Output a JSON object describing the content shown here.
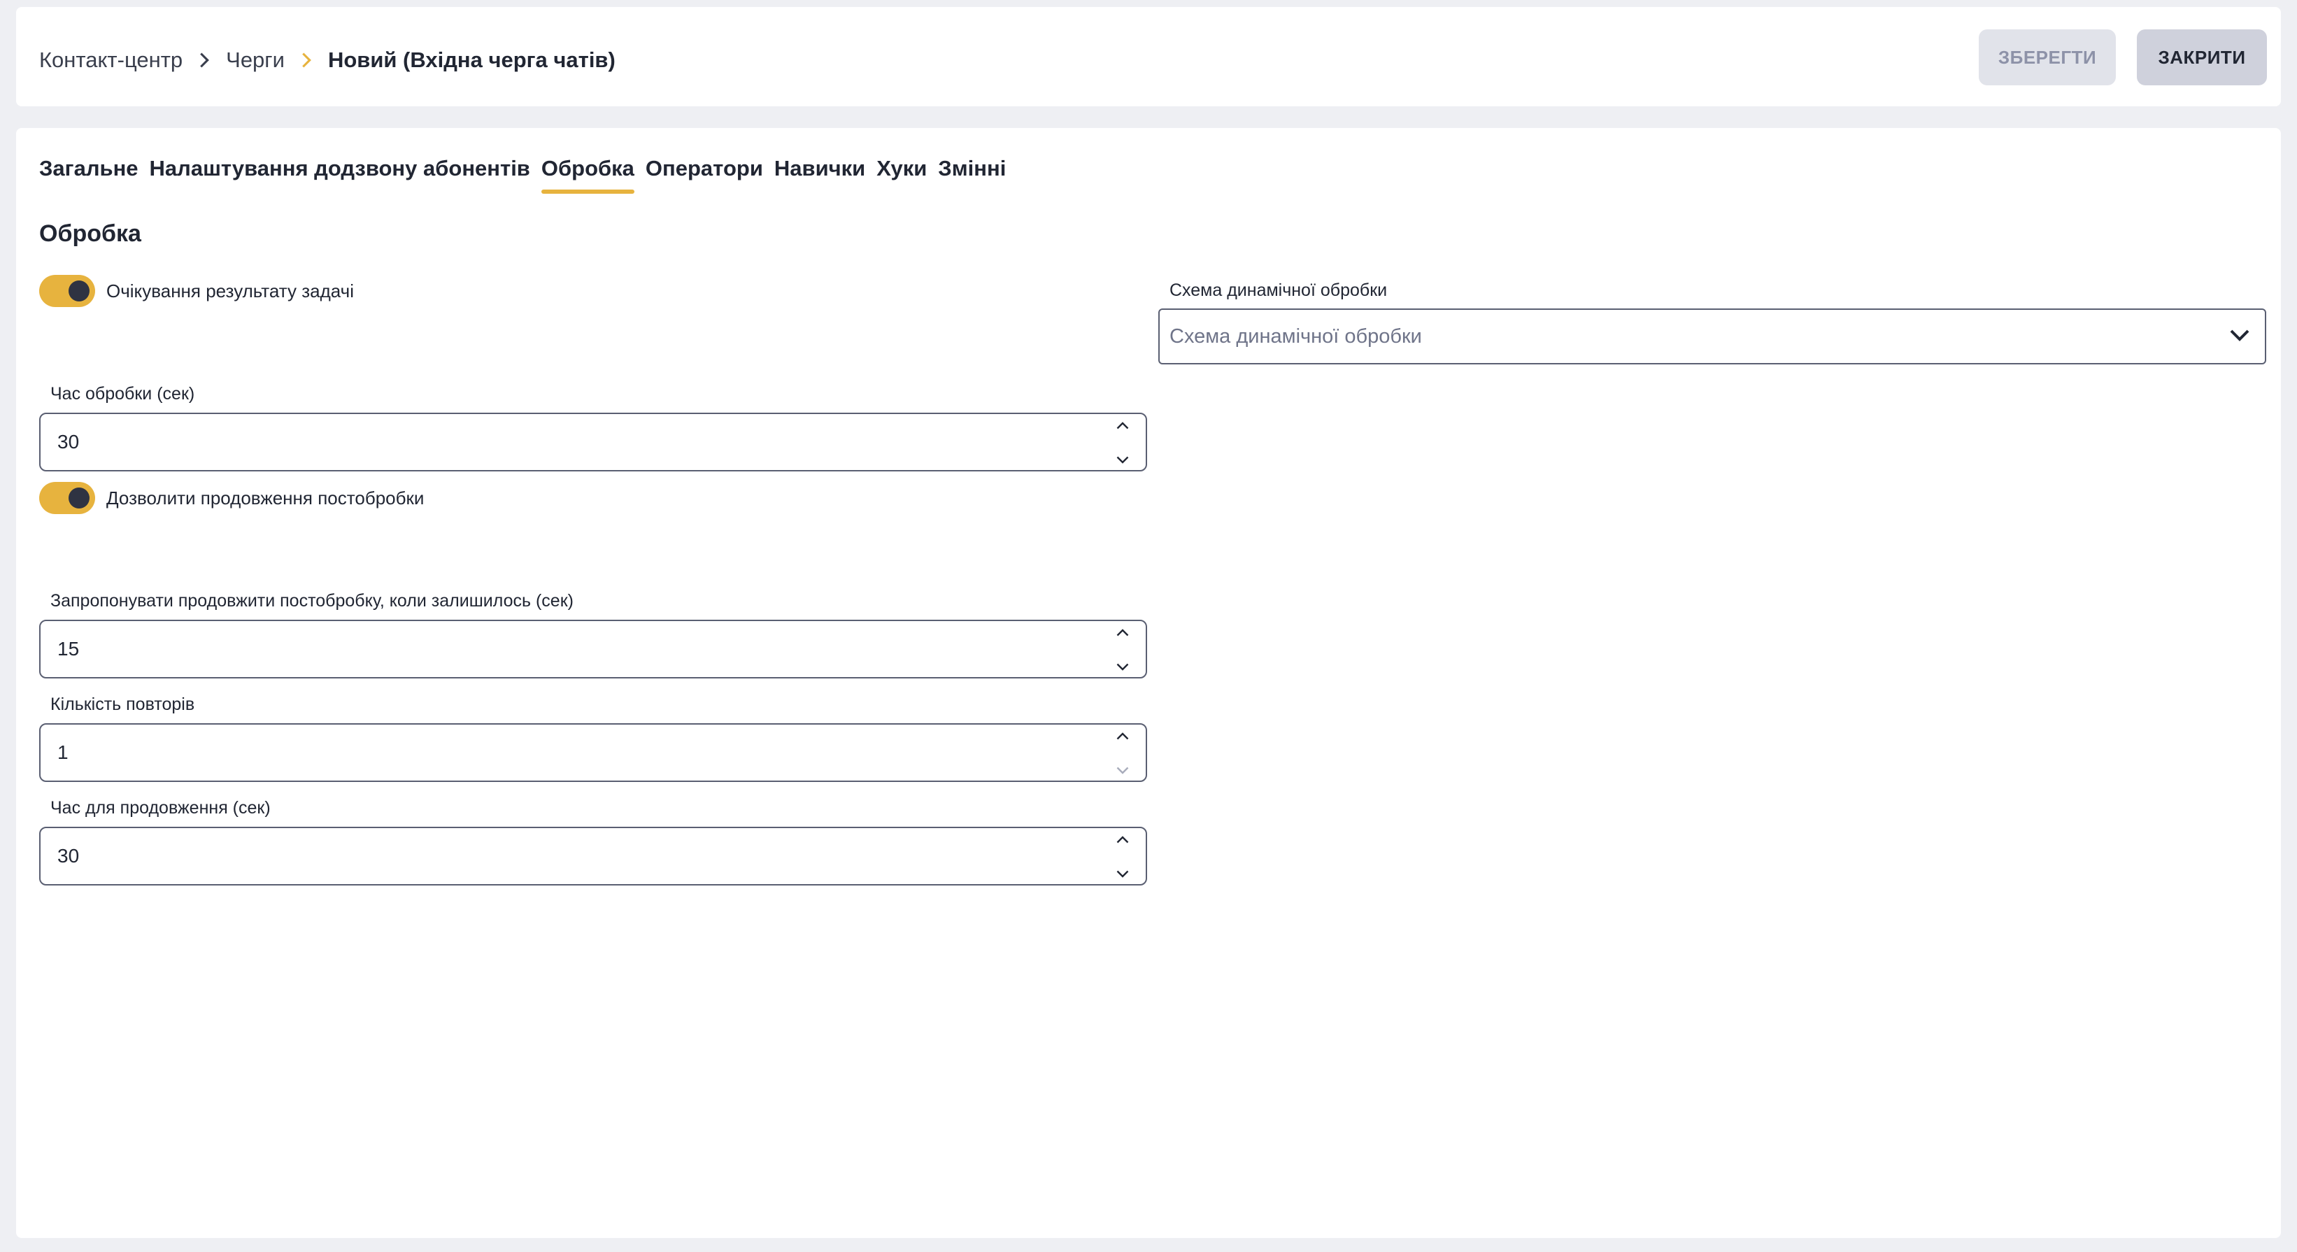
{
  "breadcrumb": {
    "items": [
      "Контакт-центр",
      "Черги"
    ],
    "current": "Новий (Вхідна черга чатів)"
  },
  "header": {
    "save_label": "ЗБЕРЕГТИ",
    "close_label": "ЗАКРИТИ"
  },
  "tabs": [
    {
      "label": "Загальне",
      "active": false
    },
    {
      "label": "Налаштування додзвону абонентів",
      "active": false
    },
    {
      "label": "Обробка",
      "active": true
    },
    {
      "label": "Оператори",
      "active": false
    },
    {
      "label": "Навички",
      "active": false
    },
    {
      "label": "Хуки",
      "active": false
    },
    {
      "label": "Змінні",
      "active": false
    }
  ],
  "section": {
    "title": "Обробка"
  },
  "toggles": {
    "await_result": {
      "label": "Очікування результату задачі",
      "on": true
    },
    "allow_extension": {
      "label": "Дозволити продовження постобробки",
      "on": true
    }
  },
  "fields": {
    "processing_time": {
      "label": "Час обробки (сек)",
      "value": "30"
    },
    "offer_extension": {
      "label": "Запропонувати продовжити постобробку, коли залишилось (сек)",
      "value": "15"
    },
    "repeat_count": {
      "label": "Кількість повторів",
      "value": "1"
    },
    "extension_time": {
      "label": "Час для продовження (сек)",
      "value": "30"
    }
  },
  "dynamic_scheme": {
    "label": "Схема динамічної обробки",
    "placeholder": "Схема динамічної обробки"
  },
  "colors": {
    "accent": "#e7b33e",
    "text": "#212633",
    "background": "#eeeff3"
  }
}
